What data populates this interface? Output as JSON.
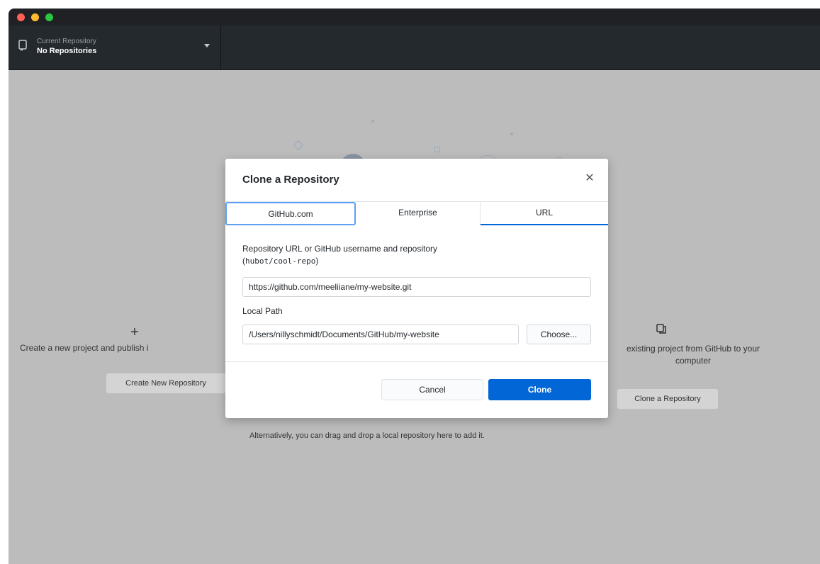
{
  "toolbar": {
    "repo_label": "Current Repository",
    "repo_value": "No Repositories"
  },
  "background": {
    "create_text": "Create a new project and publish i",
    "create_button": "Create New Repository",
    "clone_text": "existing project from GitHub to your computer",
    "clone_button": "Clone a Repository",
    "drag_hint": "Alternatively, you can drag and drop a local repository here to add it."
  },
  "dialog": {
    "title": "Clone a Repository",
    "tabs": [
      {
        "label": "GitHub.com"
      },
      {
        "label": "Enterprise"
      },
      {
        "label": "URL"
      }
    ],
    "url_label": "Repository URL or GitHub username and repository",
    "url_hint": "hubot/cool-repo",
    "url_value": "https://github.com/meeliiane/my-website.git",
    "path_label": "Local Path",
    "path_value": "/Users/nillyschmidt/Documents/GitHub/my-website",
    "choose_button": "Choose...",
    "cancel_button": "Cancel",
    "clone_button": "Clone"
  },
  "colors": {
    "accent": "#0366d6",
    "toolbar_bg": "#24292e",
    "overlay_bg": "#bcbcbc"
  },
  "icons": {
    "close": "close-icon",
    "repo": "repository-icon",
    "caret": "chevron-down-icon",
    "plus": "plus-icon",
    "clone": "clone-icon"
  }
}
